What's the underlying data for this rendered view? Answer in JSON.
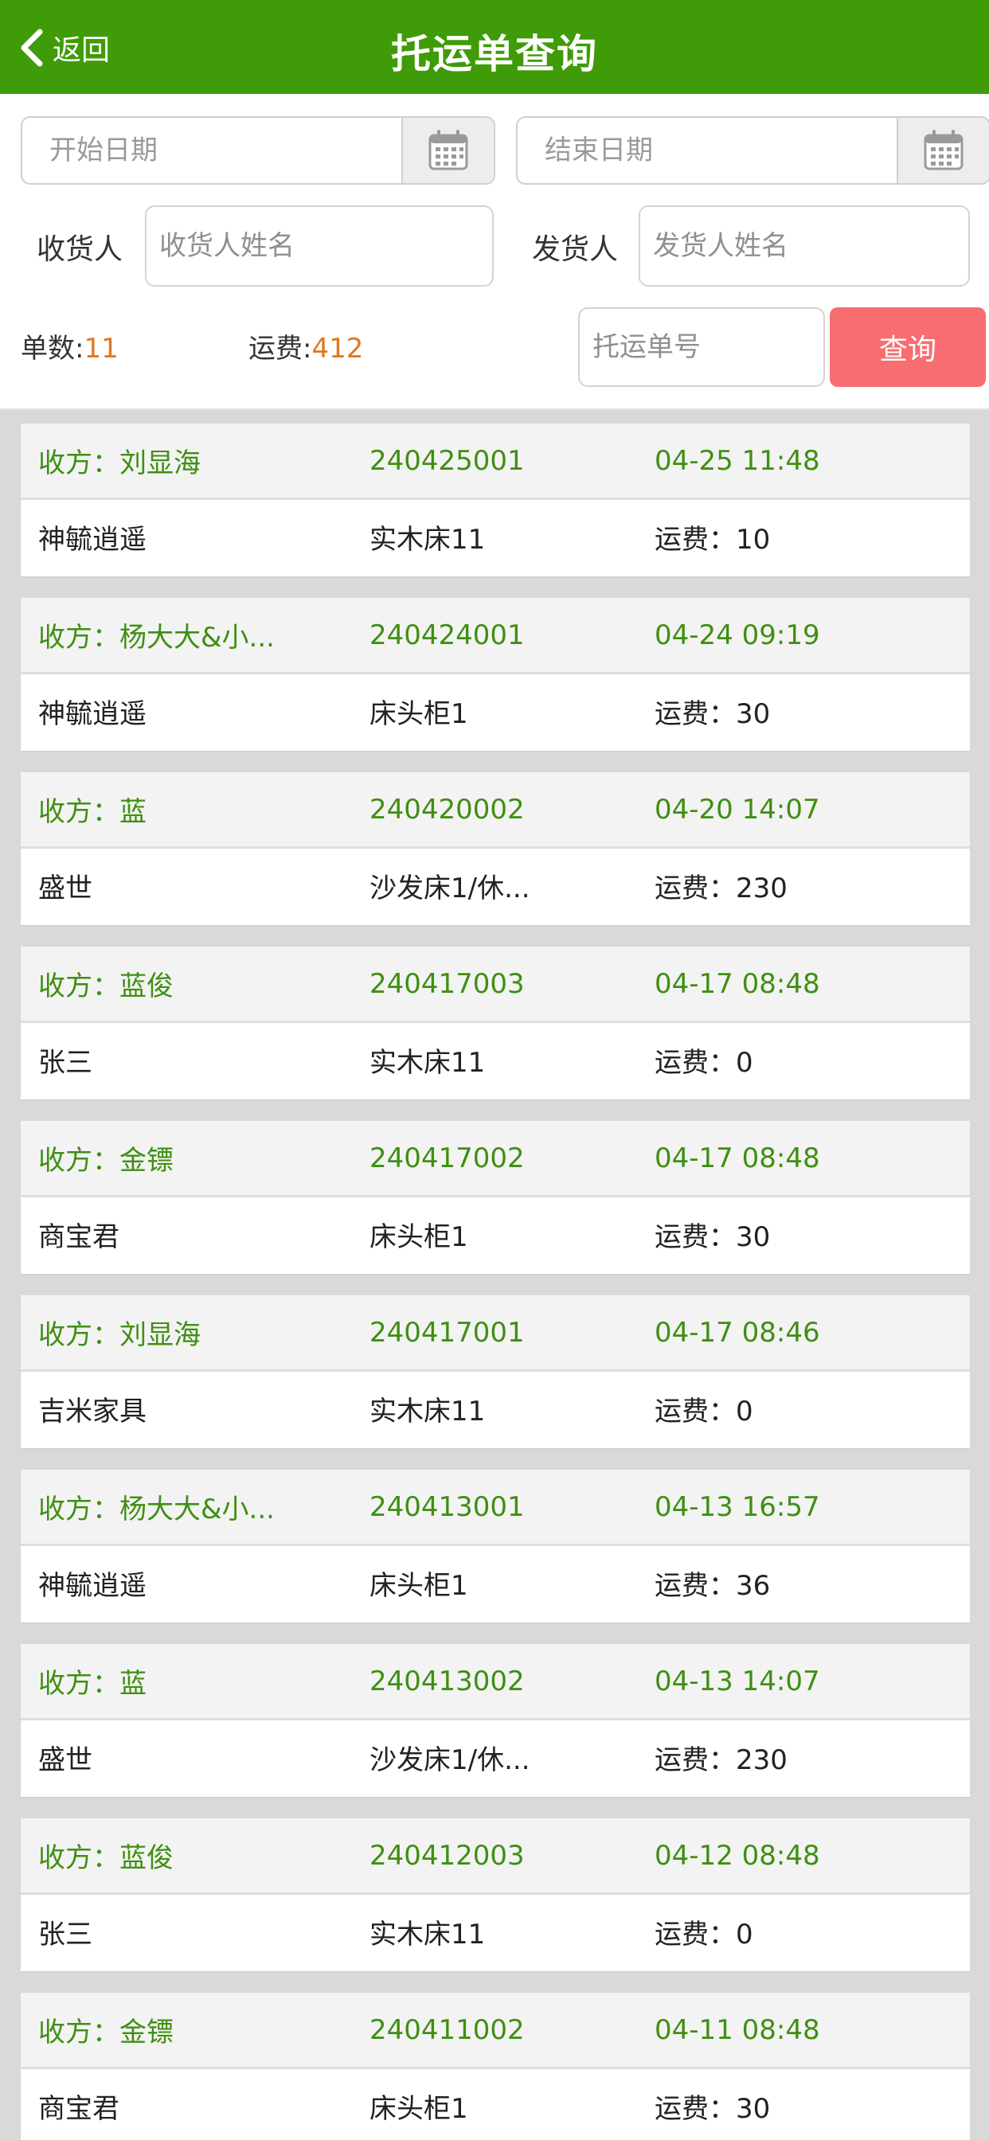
{
  "header": {
    "back_label": "返回",
    "title": "托运单查询"
  },
  "filter": {
    "start_date_placeholder": "开始日期",
    "end_date_placeholder": "结束日期",
    "receiver_label": "收货人",
    "receiver_placeholder": "收货人姓名",
    "sender_label": "发货人",
    "sender_placeholder": "发货人姓名",
    "count_label": "单数:",
    "count_value": "11",
    "fee_label": "运费:",
    "fee_value": "412",
    "order_no_placeholder": "托运单号",
    "query_label": "查询"
  },
  "colors": {
    "header_green": "#3f9b08",
    "accent_green": "#3f8f12",
    "query_red": "#f76d70",
    "stat_orange": "#e07820"
  },
  "icons": {
    "back": "chevron-left-icon",
    "calendar": "calendar-icon"
  },
  "orders": [
    {
      "receiver": "收方：刘显海",
      "order_no": "240425001",
      "time": "04-25 11:48",
      "sender": "神毓逍遥",
      "goods": "实木床11",
      "fee": "运费：10"
    },
    {
      "receiver": "收方：杨大大&小...",
      "order_no": "240424001",
      "time": "04-24 09:19",
      "sender": "神毓逍遥",
      "goods": "床头柜1",
      "fee": "运费：30"
    },
    {
      "receiver": "收方：蓝",
      "order_no": "240420002",
      "time": "04-20 14:07",
      "sender": "盛世",
      "goods": "沙发床1/休...",
      "fee": "运费：230"
    },
    {
      "receiver": "收方：蓝俊",
      "order_no": "240417003",
      "time": "04-17 08:48",
      "sender": "张三",
      "goods": "实木床11",
      "fee": "运费：0"
    },
    {
      "receiver": "收方：金镖",
      "order_no": "240417002",
      "time": "04-17 08:48",
      "sender": "商宝君",
      "goods": "床头柜1",
      "fee": "运费：30"
    },
    {
      "receiver": "收方：刘显海",
      "order_no": "240417001",
      "time": "04-17 08:46",
      "sender": "吉米家具",
      "goods": "实木床11",
      "fee": "运费：0"
    },
    {
      "receiver": "收方：杨大大&小...",
      "order_no": "240413001",
      "time": "04-13 16:57",
      "sender": "神毓逍遥",
      "goods": "床头柜1",
      "fee": "运费：36"
    },
    {
      "receiver": "收方：蓝",
      "order_no": "240413002",
      "time": "04-13 14:07",
      "sender": "盛世",
      "goods": "沙发床1/休...",
      "fee": "运费：230"
    },
    {
      "receiver": "收方：蓝俊",
      "order_no": "240412003",
      "time": "04-12 08:48",
      "sender": "张三",
      "goods": "实木床11",
      "fee": "运费：0"
    },
    {
      "receiver": "收方：金镖",
      "order_no": "240411002",
      "time": "04-11 08:48",
      "sender": "商宝君",
      "goods": "床头柜1",
      "fee": "运费：30"
    }
  ]
}
